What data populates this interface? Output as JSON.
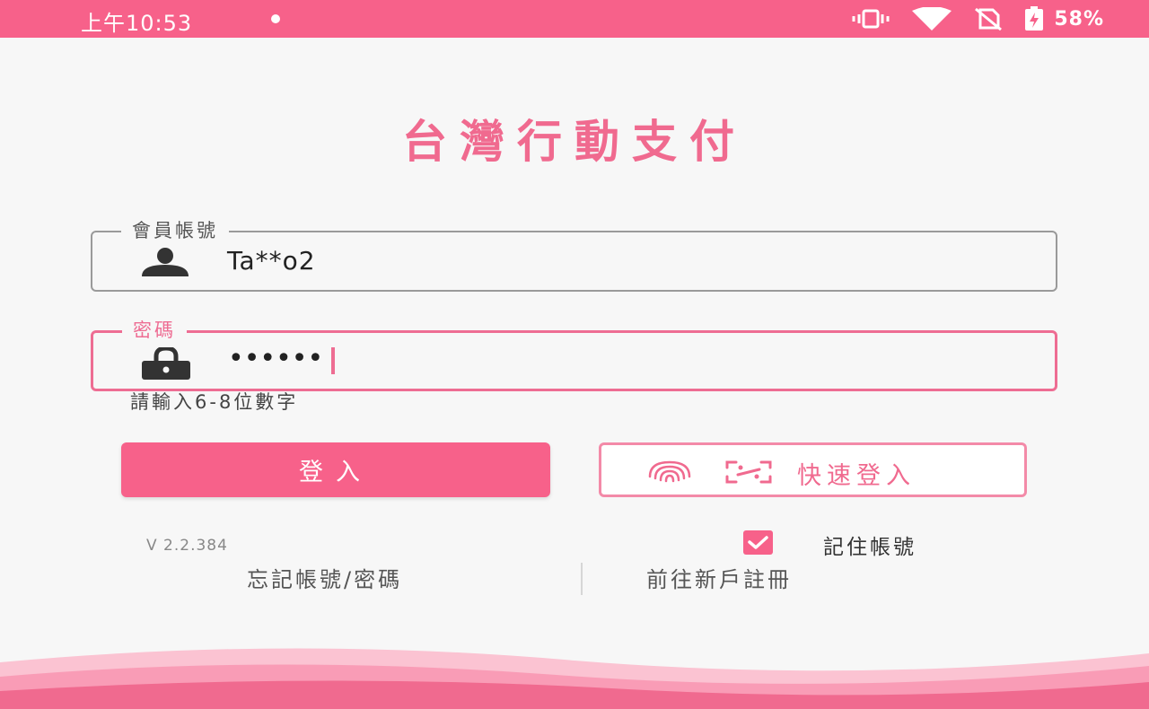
{
  "status_bar": {
    "time": "上午10:53",
    "battery_percent": "58%",
    "background_color": "#f7618a",
    "icons": [
      "vibrate-icon",
      "wifi-icon",
      "no-sim-icon",
      "battery-charging-icon"
    ]
  },
  "app": {
    "title": "台灣行動支付",
    "accent_color": "#f06a8f"
  },
  "account_field": {
    "label": "會員帳號",
    "value": "Ta**o2",
    "icon": "person-icon"
  },
  "password_field": {
    "label": "密碼",
    "value": "••••••",
    "helper": "請輸入6-8位數字",
    "icon": "lock-icon"
  },
  "buttons": {
    "login_label": "登入",
    "quick_login_label": "快速登入",
    "quick_login_icons": [
      "fingerprint-icon",
      "face-id-icon"
    ]
  },
  "footer": {
    "version": "V 2.2.384",
    "remember_label": "記住帳號",
    "remember_checked": true,
    "forgot_link": "忘記帳號/密碼",
    "register_link": "前往新戶註冊"
  }
}
